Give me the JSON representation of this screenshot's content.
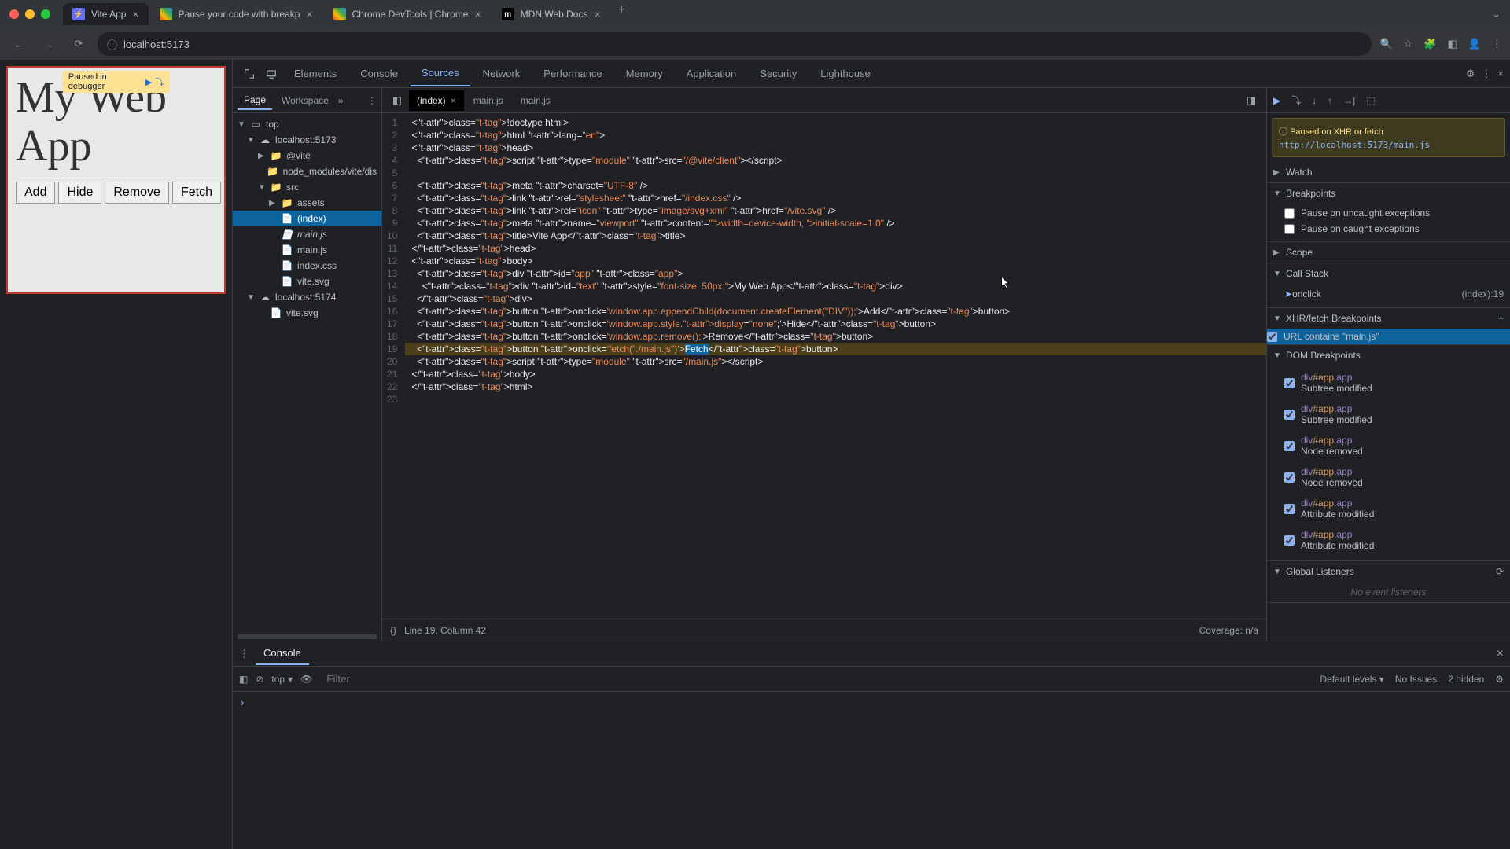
{
  "window": {
    "tabs": [
      {
        "title": "Vite App",
        "fav": "V"
      },
      {
        "title": "Pause your code with breakp",
        "fav": "C"
      },
      {
        "title": "Chrome DevTools | Chrome",
        "fav": "C"
      },
      {
        "title": "MDN Web Docs",
        "fav": "M"
      }
    ]
  },
  "address": {
    "url": "localhost:5173"
  },
  "page": {
    "paused_badge": "Paused in debugger",
    "title": "My Web App",
    "buttons": [
      "Add",
      "Hide",
      "Remove",
      "Fetch"
    ]
  },
  "devtools": {
    "tabs": [
      "Elements",
      "Console",
      "Sources",
      "Network",
      "Performance",
      "Memory",
      "Application",
      "Security",
      "Lighthouse"
    ],
    "active_tab": "Sources"
  },
  "navigator": {
    "tabs": [
      "Page",
      "Workspace"
    ],
    "tree": {
      "top": "top",
      "host1": "localhost:5173",
      "vite": "@vite",
      "nodemod": "node_modules/vite/dis",
      "src": "src",
      "assets": "assets",
      "index": "(index)",
      "mainjs1": "main.js",
      "mainjs2": "main.js",
      "indexcss": "index.css",
      "vitesvg": "vite.svg",
      "host2": "localhost:5174",
      "vitesvg2": "vite.svg"
    }
  },
  "editor": {
    "tabs": [
      "(index)",
      "main.js",
      "main.js"
    ],
    "active": 0,
    "status_line": "Line 19, Column 42",
    "coverage": "Coverage: n/a",
    "lines": [
      "<!doctype html>",
      "<html lang=\"en\">",
      "<head>",
      "  <script type=\"module\" src=\"/@vite/client\"></​script>",
      "",
      "  <meta charset=\"UTF-8\" />",
      "  <link rel=\"stylesheet\" href=\"/index.css\" />",
      "  <link rel=\"icon\" type=\"image/svg+xml\" href=\"/vite.svg\" />",
      "  <meta name=\"viewport\" content=\"width=device-width, initial-scale=1.0\" />",
      "  <title>Vite App</title>",
      "</head>",
      "<body>",
      "  <div id=\"app\" class=\"app\">",
      "    <div id=\"text\" style=\"font-size: 50px;\">My Web App</div>",
      "  </div>",
      "  <button onclick='window.app.appendChild(document.createElement(\"DIV\"));'>Add</button>",
      "  <button onclick='window.app.style.display=\"none\";'>Hide</button>",
      "  <button onclick='window.app.remove();'>Remove</button>",
      "  <button onclick='fetch(\"./main.js\")'>Fetch</button>",
      "  <script type=\"module\" src=\"/main.js\"></​script>",
      "</body>",
      "</html>",
      ""
    ]
  },
  "debugger": {
    "pause_reason": "Paused on XHR or fetch",
    "pause_url": "http://localhost:5173/main.js",
    "watch": "Watch",
    "breakpoints": "Breakpoints",
    "pause_uncaught": "Pause on uncaught exceptions",
    "pause_caught": "Pause on caught exceptions",
    "scope": "Scope",
    "callstack": "Call Stack",
    "stack_frame": "onclick",
    "stack_loc": "(index):19",
    "xhr_section": "XHR/fetch Breakpoints",
    "xhr_item": "URL contains \"main.js\"",
    "dom_section": "DOM Breakpoints",
    "dom_items": [
      {
        "node": "div#app.app",
        "kind": "Subtree modified"
      },
      {
        "node": "div#app.app",
        "kind": "Subtree modified"
      },
      {
        "node": "div#app.app",
        "kind": "Node removed"
      },
      {
        "node": "div#app.app",
        "kind": "Node removed"
      },
      {
        "node": "div#app.app",
        "kind": "Attribute modified"
      },
      {
        "node": "div#app.app",
        "kind": "Attribute modified"
      }
    ],
    "global_listeners": "Global Listeners",
    "no_listeners": "No event listeners"
  },
  "drawer": {
    "tab": "Console",
    "context": "top",
    "filter_placeholder": "Filter",
    "levels": "Default levels",
    "issues": "No Issues",
    "hidden": "2 hidden",
    "prompt": "›"
  }
}
